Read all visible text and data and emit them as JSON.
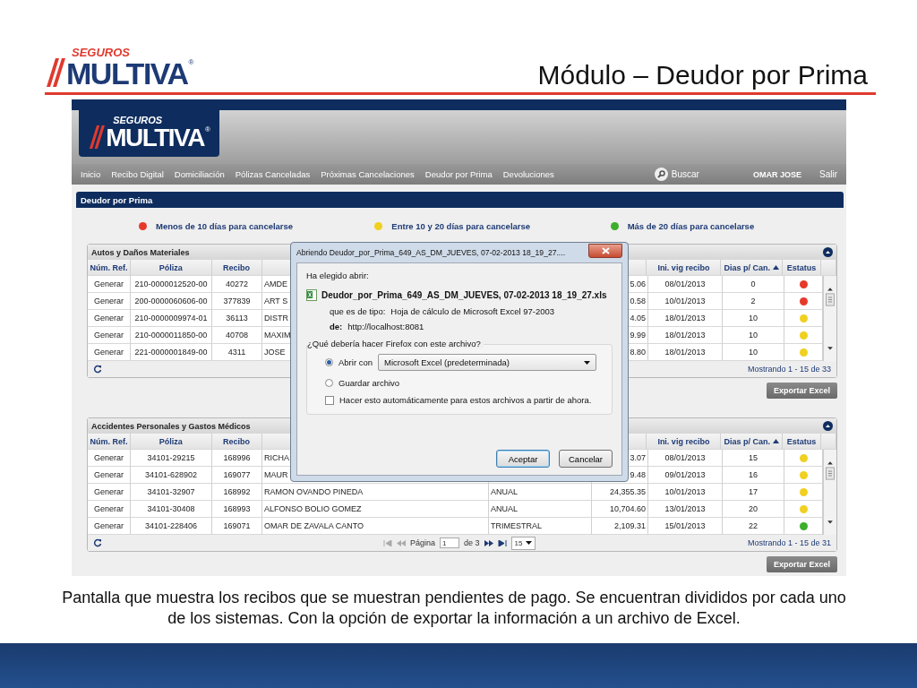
{
  "slide": {
    "logo": {
      "top": "SEGUROS",
      "name": "MULTIVA",
      "mark": "®"
    },
    "title": "Módulo – Deudor por Prima"
  },
  "app": {
    "logo": {
      "top": "SEGUROS",
      "name": "MULTIVA",
      "mark": "®"
    },
    "nav": [
      "Inicio",
      "Recibo Digital",
      "Domiciliación",
      "Pólizas Canceladas",
      "Próximas Cancelaciones",
      "Deudor por Prima",
      "Devoluciones"
    ],
    "search": "Buscar",
    "user": "OMAR JOSE",
    "logout": "Salir",
    "panel_title": "Deudor por Prima",
    "legend": [
      {
        "label": "Menos de 10 días para cancelarse",
        "color": "#e53a2a"
      },
      {
        "label": "Entre 10 y 20 días para cancelarse",
        "color": "#f0d020"
      },
      {
        "label": "Más de 20 días para cancelarse",
        "color": "#3cae2c"
      }
    ],
    "tables": [
      {
        "title": "Autos y Daños Materiales",
        "columns": [
          {
            "label": "Núm. Ref."
          },
          {
            "label": "Póliza"
          },
          {
            "label": "Recibo"
          },
          {
            "label": "Ini. vig recibo"
          },
          {
            "label": "Dias p/ Can.",
            "sorted": true
          },
          {
            "label": "Estatus"
          }
        ],
        "rows": [
          {
            "ref": "Generar",
            "poliza": "210-0000012520-00",
            "recibo": "40272",
            "column_4": "AMDE",
            "column_6": "5.06",
            "ini_vig": "08/01/2013",
            "dias": "0",
            "color": "#e53a2a"
          },
          {
            "ref": "Generar",
            "poliza": "200-0000060606-00",
            "recibo": "377839",
            "column_4": "ART S",
            "column_6": "0.58",
            "ini_vig": "10/01/2013",
            "dias": "2",
            "color": "#e53a2a"
          },
          {
            "ref": "Generar",
            "poliza": "210-0000009974-01",
            "recibo": "36113",
            "column_4": "DISTR",
            "column_6": "4.05",
            "ini_vig": "18/01/2013",
            "dias": "10",
            "color": "#f0d020"
          },
          {
            "ref": "Generar",
            "poliza": "210-0000011850-00",
            "recibo": "40708",
            "column_4": "MAXIM",
            "column_6": "9.99",
            "ini_vig": "18/01/2013",
            "dias": "10",
            "color": "#f0d020"
          },
          {
            "ref": "Generar",
            "poliza": "221-0000001849-00",
            "recibo": "4311",
            "column_4": "JOSE",
            "column_6": "8.80",
            "ini_vig": "18/01/2013",
            "dias": "10",
            "color": "#f0d020"
          }
        ],
        "summary": "Mostrando 1 - 15 de 33",
        "export": "Exportar Excel"
      },
      {
        "title": "Accidentes Personales y Gastos Médicos",
        "columns": [
          {
            "label": "Núm. Ref."
          },
          {
            "label": "Póliza"
          },
          {
            "label": "Recibo"
          },
          {
            "label": "Ini. vig recibo"
          },
          {
            "label": "Dias p/ Can.",
            "sorted": true
          },
          {
            "label": "Estatus"
          }
        ],
        "rows": [
          {
            "ref": "Generar",
            "poliza": "34101-29215",
            "recibo": "168996",
            "column_4": "RICHA",
            "column_6": "3.07",
            "ini_vig": "08/01/2013",
            "dias": "15",
            "color": "#f0d020"
          },
          {
            "ref": "Generar",
            "poliza": "34101-628902",
            "recibo": "169077",
            "column_4": "MAUR",
            "column_6": "9.48",
            "ini_vig": "09/01/2013",
            "dias": "16",
            "color": "#f0d020"
          },
          {
            "ref": "Generar",
            "poliza": "34101-32907",
            "recibo": "168992",
            "column_4": "RAMON OVANDO PINEDA",
            "column_5": "ANUAL",
            "column_6": "24,355.35",
            "ini_vig": "10/01/2013",
            "dias": "17",
            "color": "#f0d020"
          },
          {
            "ref": "Generar",
            "poliza": "34101-30408",
            "recibo": "168993",
            "column_4": "ALFONSO BOLIO GOMEZ",
            "column_5": "ANUAL",
            "column_6": "10,704.60",
            "ini_vig": "13/01/2013",
            "dias": "20",
            "color": "#f0d020"
          },
          {
            "ref": "Generar",
            "poliza": "34101-228406",
            "recibo": "169071",
            "column_4": "OMAR DE ZAVALA CANTO",
            "column_5": "TRIMESTRAL",
            "column_6": "2,109.31",
            "ini_vig": "15/01/2013",
            "dias": "22",
            "color": "#3cae2c"
          }
        ],
        "pager": {
          "page_label": "Página",
          "page": "1",
          "of": "de 3",
          "page_size": "15"
        },
        "summary": "Mostrando 1 - 15 de 31",
        "export": "Exportar Excel"
      }
    ],
    "dialog": {
      "title": "Abriendo Deudor_por_Prima_649_AS_DM_JUEVES, 07-02-2013 18_19_27....",
      "intro": "Ha elegido abrir:",
      "filename": "Deudor_por_Prima_649_AS_DM_JUEVES, 07-02-2013 18_19_27.xls",
      "type_label": "que es de tipo:",
      "type": "Hoja de cálculo de Microsoft Excel 97-2003",
      "from_label": "de:",
      "from": "http://localhost:8081",
      "question": "¿Qué debería hacer Firefox con este archivo?",
      "options": [
        {
          "label": "Abrir con",
          "selected": true
        },
        {
          "label": "Guardar archivo",
          "selected": false
        }
      ],
      "app_select": "Microsoft Excel (predeterminada)",
      "auto": {
        "label": "Hacer esto automáticamente para estos archivos a partir de ahora.",
        "checked": false
      },
      "buttons": [
        {
          "label": "Aceptar",
          "focused": true
        },
        {
          "label": "Cancelar",
          "focused": false
        }
      ]
    }
  },
  "caption": "Pantalla que muestra los recibos que se muestran pendientes de pago. Se encuentran divididos por cada uno de los sistemas. Con la opción de exportar la información a un archivo de Excel."
}
